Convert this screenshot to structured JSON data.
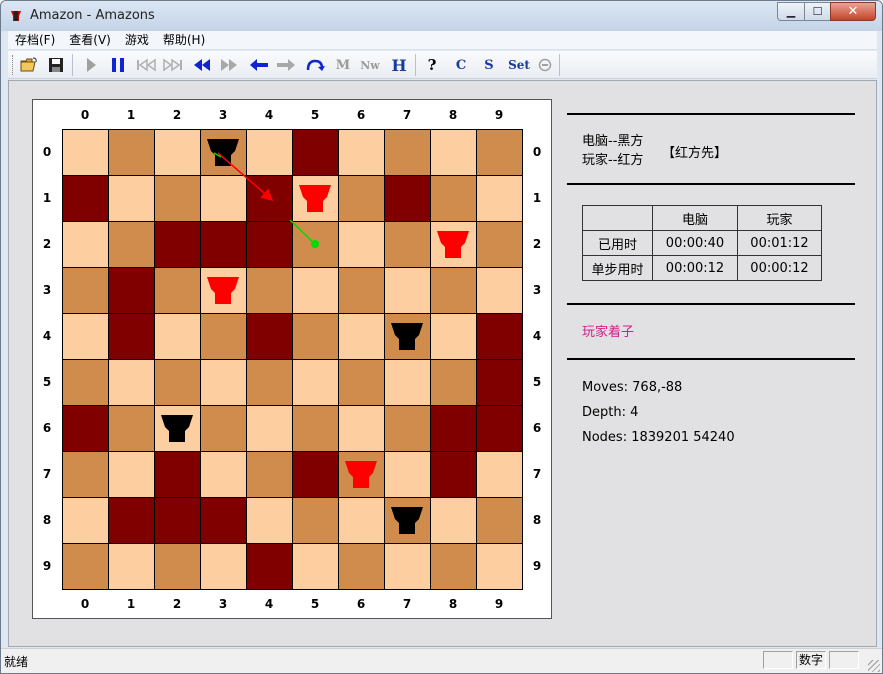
{
  "window": {
    "title": "Amazon - Amazons",
    "min_glyph": "▁",
    "max_glyph": "☐",
    "close_glyph": "✕"
  },
  "menu": [
    "存档(F)",
    "查看(V)",
    "游戏",
    "帮助(H)"
  ],
  "toolbar": {
    "buttons": [
      {
        "name": "open-icon",
        "enabled": true
      },
      {
        "name": "save-icon",
        "enabled": true
      },
      {
        "name": "play-icon",
        "enabled": false
      },
      {
        "name": "pause-icon",
        "enabled": true
      },
      {
        "name": "first-move-icon",
        "enabled": false
      },
      {
        "name": "last-move-icon",
        "enabled": false
      },
      {
        "name": "fast-back-icon",
        "enabled": true
      },
      {
        "name": "fast-forward-icon",
        "enabled": false
      },
      {
        "name": "step-back-icon",
        "enabled": true
      },
      {
        "name": "step-forward-icon",
        "enabled": false
      },
      {
        "name": "undo-arc-icon",
        "enabled": true
      },
      {
        "name": "m-icon",
        "enabled": false
      },
      {
        "name": "new-icon",
        "enabled": false
      },
      {
        "name": "h-icon",
        "enabled": true
      },
      {
        "name": "help-icon",
        "enabled": true
      },
      {
        "name": "c-icon",
        "enabled": true
      },
      {
        "name": "s-icon",
        "enabled": true
      },
      {
        "name": "set-icon",
        "enabled": true
      },
      {
        "name": "stop-icon",
        "enabled": false
      }
    ],
    "m_label": "M",
    "new_label": "Nw",
    "h_label": "H",
    "help_label": "?",
    "c_label": "C",
    "s_label": "S",
    "set_label": "Set"
  },
  "board": {
    "col_labels": [
      "0",
      "1",
      "2",
      "3",
      "4",
      "5",
      "6",
      "7",
      "8",
      "9"
    ],
    "row_labels": [
      "0",
      "1",
      "2",
      "3",
      "4",
      "5",
      "6",
      "7",
      "8",
      "9"
    ],
    "blocked": [
      [
        0,
        5
      ],
      [
        1,
        0
      ],
      [
        1,
        4
      ],
      [
        1,
        7
      ],
      [
        2,
        2
      ],
      [
        2,
        3
      ],
      [
        2,
        4
      ],
      [
        3,
        1
      ],
      [
        4,
        1
      ],
      [
        4,
        4
      ],
      [
        4,
        9
      ],
      [
        5,
        9
      ],
      [
        6,
        0
      ],
      [
        6,
        8
      ],
      [
        6,
        9
      ],
      [
        7,
        2
      ],
      [
        7,
        5
      ],
      [
        7,
        8
      ],
      [
        8,
        1
      ],
      [
        8,
        2
      ],
      [
        8,
        3
      ],
      [
        9,
        4
      ]
    ],
    "pieces": [
      {
        "row": 0,
        "col": 3,
        "color": "black"
      },
      {
        "row": 4,
        "col": 7,
        "color": "black"
      },
      {
        "row": 6,
        "col": 2,
        "color": "black"
      },
      {
        "row": 8,
        "col": 7,
        "color": "black"
      },
      {
        "row": 1,
        "col": 5,
        "color": "red"
      },
      {
        "row": 2,
        "col": 8,
        "color": "red"
      },
      {
        "row": 3,
        "col": 3,
        "color": "red"
      },
      {
        "row": 7,
        "col": 6,
        "color": "red"
      }
    ],
    "light_color": "#fdcea0",
    "dark_color": "#cf8c4c",
    "blocked_color": "#800000",
    "red_piece_color": "#ff0000",
    "black_piece_color": "#000000",
    "move_arrow_color": "#ff0000",
    "shot_line_color": "#00dd00"
  },
  "info": {
    "computer_side": "电脑--黑方",
    "player_side": "玩家--红方",
    "first_move": "【红方先】",
    "timer": {
      "headers": [
        "",
        "电脑",
        "玩家"
      ],
      "rows": [
        {
          "label": "已用时",
          "computer": "00:00:40",
          "player": "00:01:12"
        },
        {
          "label": "单步用时",
          "computer": "00:00:12",
          "player": "00:00:12"
        }
      ]
    },
    "status_message": "玩家着子",
    "moves": "Moves: 768,-88",
    "depth": "Depth: 4",
    "nodes": "Nodes: 1839201 54240"
  },
  "statusbar": {
    "text": "就绪",
    "num_lock": "数字"
  }
}
